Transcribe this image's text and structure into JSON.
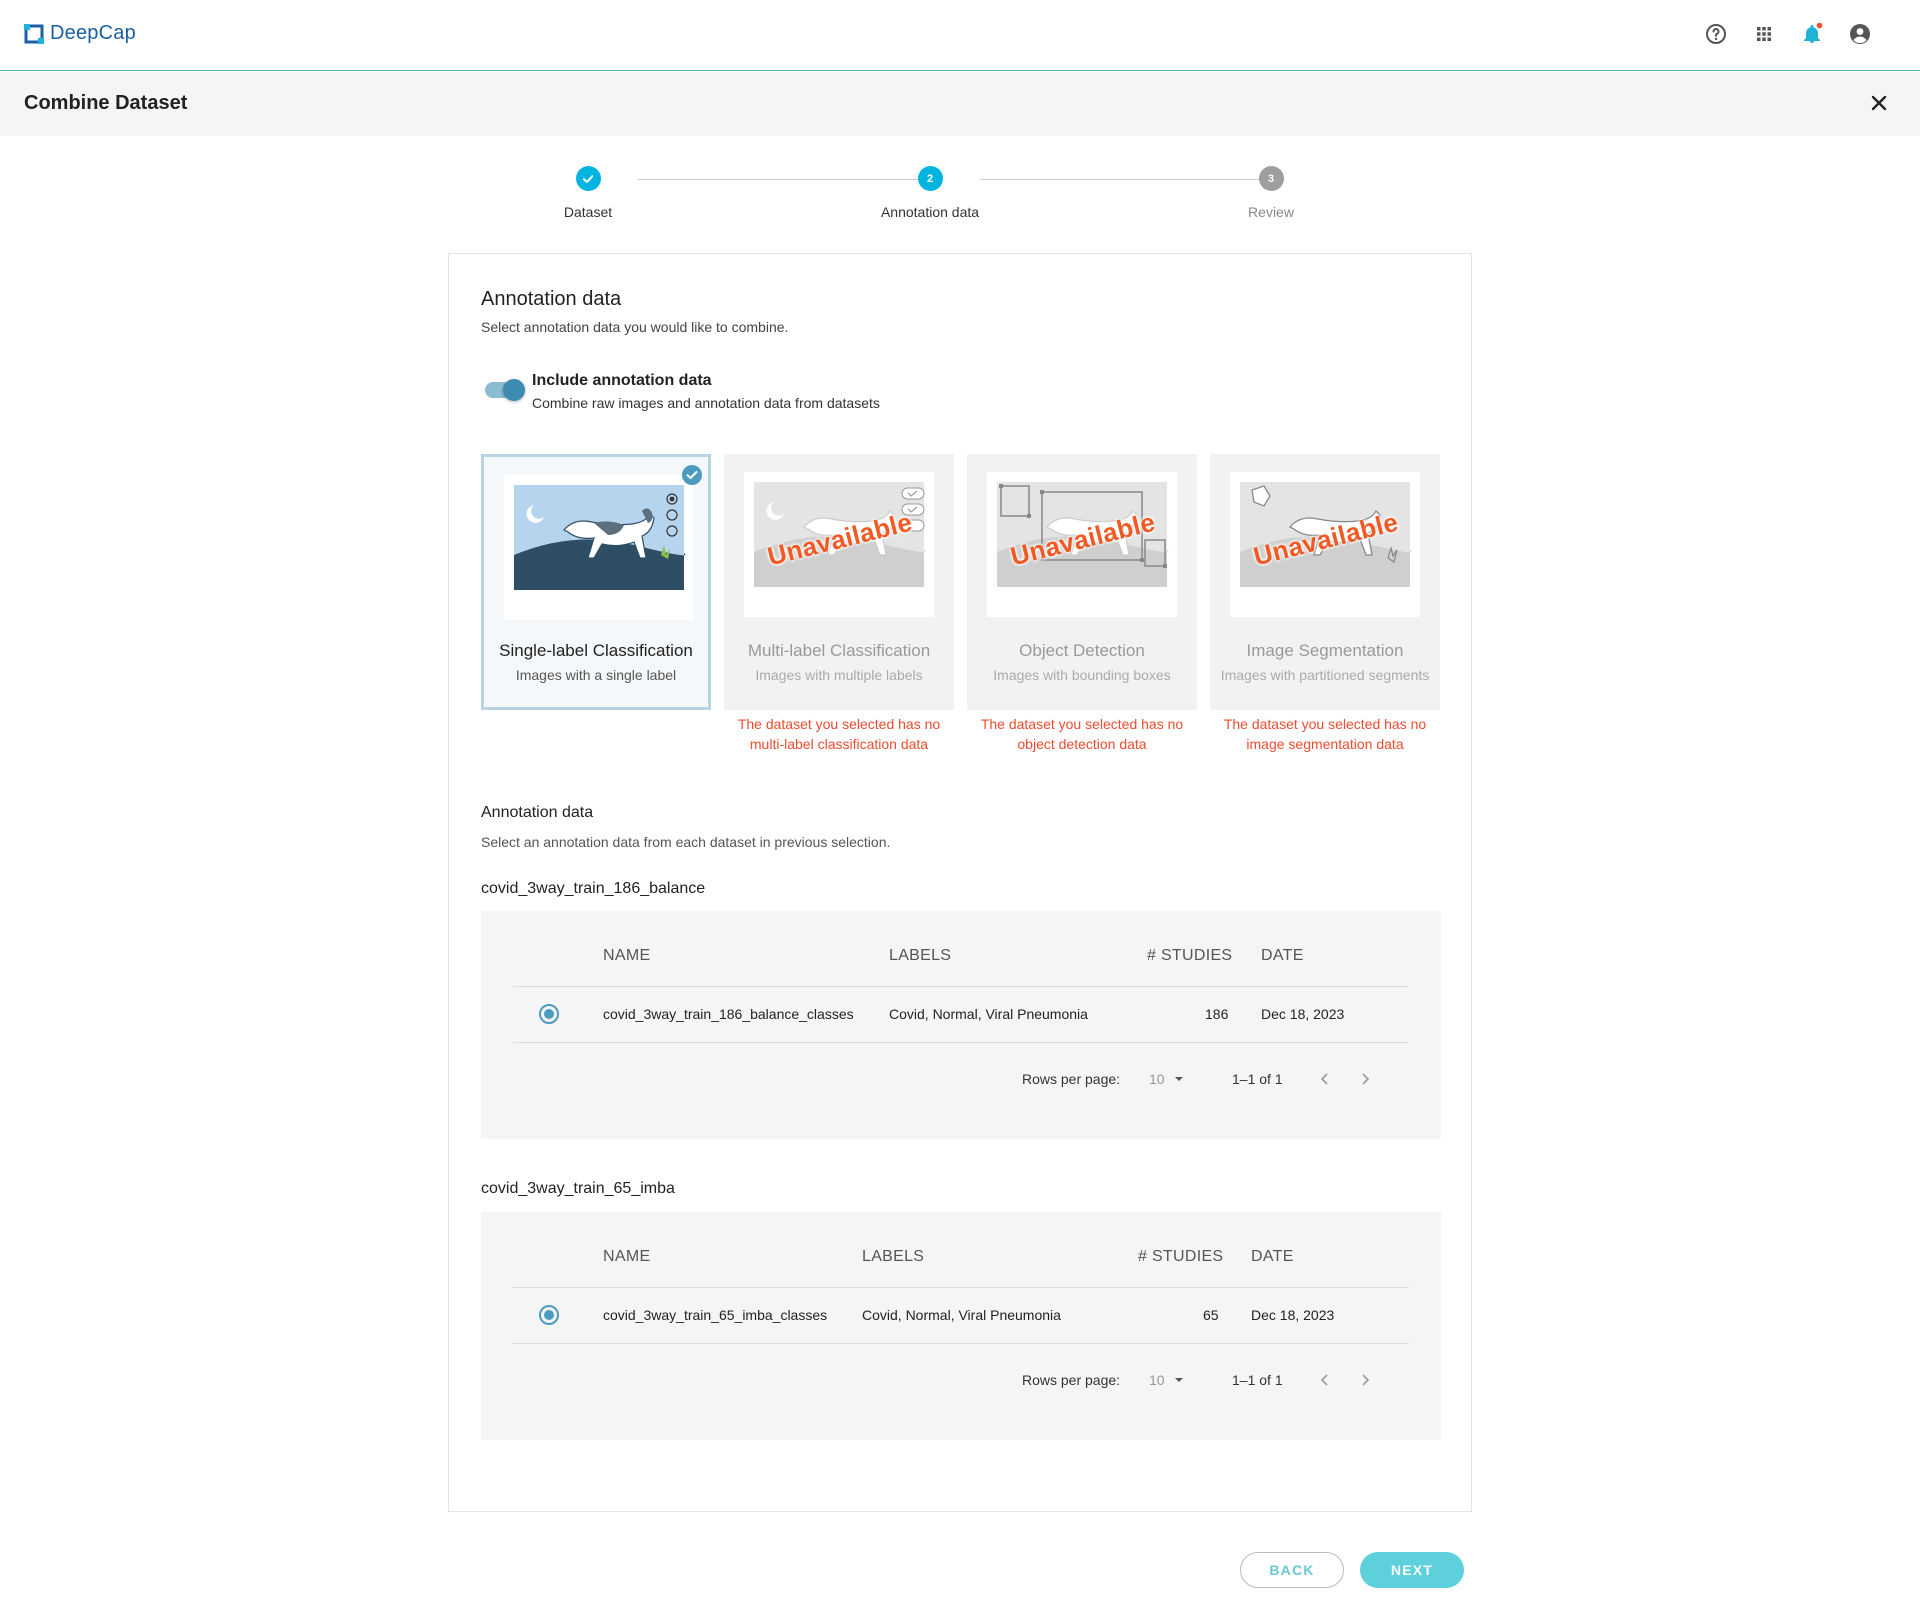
{
  "app": {
    "name": "DeepCap"
  },
  "header": {
    "icons": [
      "help-circle-icon",
      "apps-grid-icon",
      "bell-icon",
      "account-circle-icon"
    ]
  },
  "page": {
    "title": "Combine Dataset"
  },
  "stepper": {
    "steps": [
      {
        "label": "Dataset",
        "state": "done",
        "number": "1"
      },
      {
        "label": "Annotation data",
        "state": "active",
        "number": "2"
      },
      {
        "label": "Review",
        "state": "todo",
        "number": "3"
      }
    ]
  },
  "annotation": {
    "title": "Annotation data",
    "subtitle": "Select annotation data you would like to combine.",
    "toggle": {
      "title": "Include annotation data",
      "subtitle": "Combine raw images and annotation data from datasets",
      "on": true
    }
  },
  "types": [
    {
      "title": "Single-label Classification",
      "subtitle": "Images with a single label",
      "selected": true,
      "available": true,
      "warning": ""
    },
    {
      "title": "Multi-label Classification",
      "subtitle": "Images with multiple labels",
      "selected": false,
      "available": false,
      "badge": "Unavailable",
      "warning": "The dataset you selected has no multi-label classification data"
    },
    {
      "title": "Object Detection",
      "subtitle": "Images with bounding boxes",
      "selected": false,
      "available": false,
      "badge": "Unavailable",
      "warning": "The dataset you selected has no object detection data"
    },
    {
      "title": "Image Segmentation",
      "subtitle": "Images with partitioned segments",
      "selected": false,
      "available": false,
      "badge": "Unavailable",
      "warning": "The dataset you selected has no image segmentation data"
    }
  ],
  "selection": {
    "title": "Annotation data",
    "subtitle": "Select an annotation data from each dataset in previous selection."
  },
  "datasets": [
    {
      "name": "covid_3way_train_186_balance",
      "columns": [
        "NAME",
        "LABELS",
        "# STUDIES",
        "DATE"
      ],
      "rows": [
        {
          "name": "covid_3way_train_186_balance_classes",
          "labels": "Covid, Normal, Viral Pneumonia",
          "studies": "186",
          "date": "Dec 18, 2023",
          "selected": true
        }
      ],
      "pager": {
        "rows_label": "Rows per page:",
        "rows_value": "10",
        "range": "1–1 of 1"
      }
    },
    {
      "name": "covid_3way_train_65_imba",
      "columns": [
        "NAME",
        "LABELS",
        "# STUDIES",
        "DATE"
      ],
      "rows": [
        {
          "name": "covid_3way_train_65_imba_classes",
          "labels": "Covid, Normal, Viral Pneumonia",
          "studies": "65",
          "date": "Dec 18, 2023",
          "selected": true
        }
      ],
      "pager": {
        "rows_label": "Rows per page:",
        "rows_value": "10",
        "range": "1–1 of 1"
      }
    }
  ],
  "buttons": {
    "back": "BACK",
    "next": "NEXT"
  },
  "colors": {
    "accent": "#00b4e0",
    "primary": "#4d9cc0",
    "warning": "#ef4b2f",
    "next_button": "#5dd0dc"
  }
}
